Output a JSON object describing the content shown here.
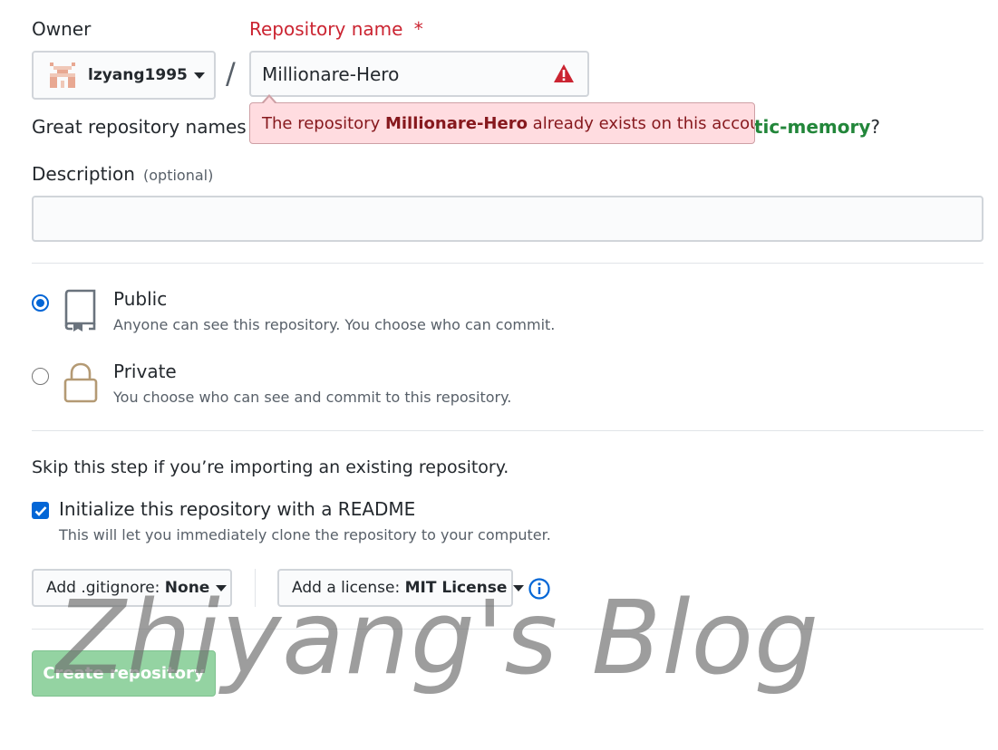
{
  "owner": {
    "label": "Owner",
    "value": "lzyang1995"
  },
  "repo": {
    "label": "Repository name",
    "required_mark": "*",
    "value": "Millionare-Hero",
    "error_prefix": "The repository ",
    "error_name": "Millionare-Hero",
    "error_suffix": " already exists on this account."
  },
  "separator": "/",
  "suggestion": {
    "prefix": "Great repository names ar",
    "link_tail": "stic-memory",
    "suffix": "?"
  },
  "description": {
    "label": "Description",
    "optional": "(optional)",
    "value": ""
  },
  "visibility": {
    "public": {
      "title": "Public",
      "desc": "Anyone can see this repository. You choose who can commit.",
      "selected": true
    },
    "private": {
      "title": "Private",
      "desc": "You choose who can see and commit to this repository.",
      "selected": false
    }
  },
  "init": {
    "skip_text": "Skip this step if you’re importing an existing repository.",
    "readme_label": "Initialize this repository with a README",
    "readme_desc": "This will let you immediately clone the repository to your computer.",
    "readme_checked": true
  },
  "gitignore": {
    "prefix": "Add .gitignore: ",
    "value": "None"
  },
  "license": {
    "prefix": "Add a license: ",
    "value": "MIT License"
  },
  "create_button": "Create repository",
  "watermark": "Zhiyang's Blog",
  "colors": {
    "error": "#cb2431",
    "link": "#22863a",
    "primary": "#2ea44f",
    "accent": "#0366d6"
  },
  "icons": [
    "avatar",
    "warning-icon",
    "repo-icon",
    "lock-icon",
    "info-icon",
    "check-icon",
    "chevron-down-icon"
  ]
}
